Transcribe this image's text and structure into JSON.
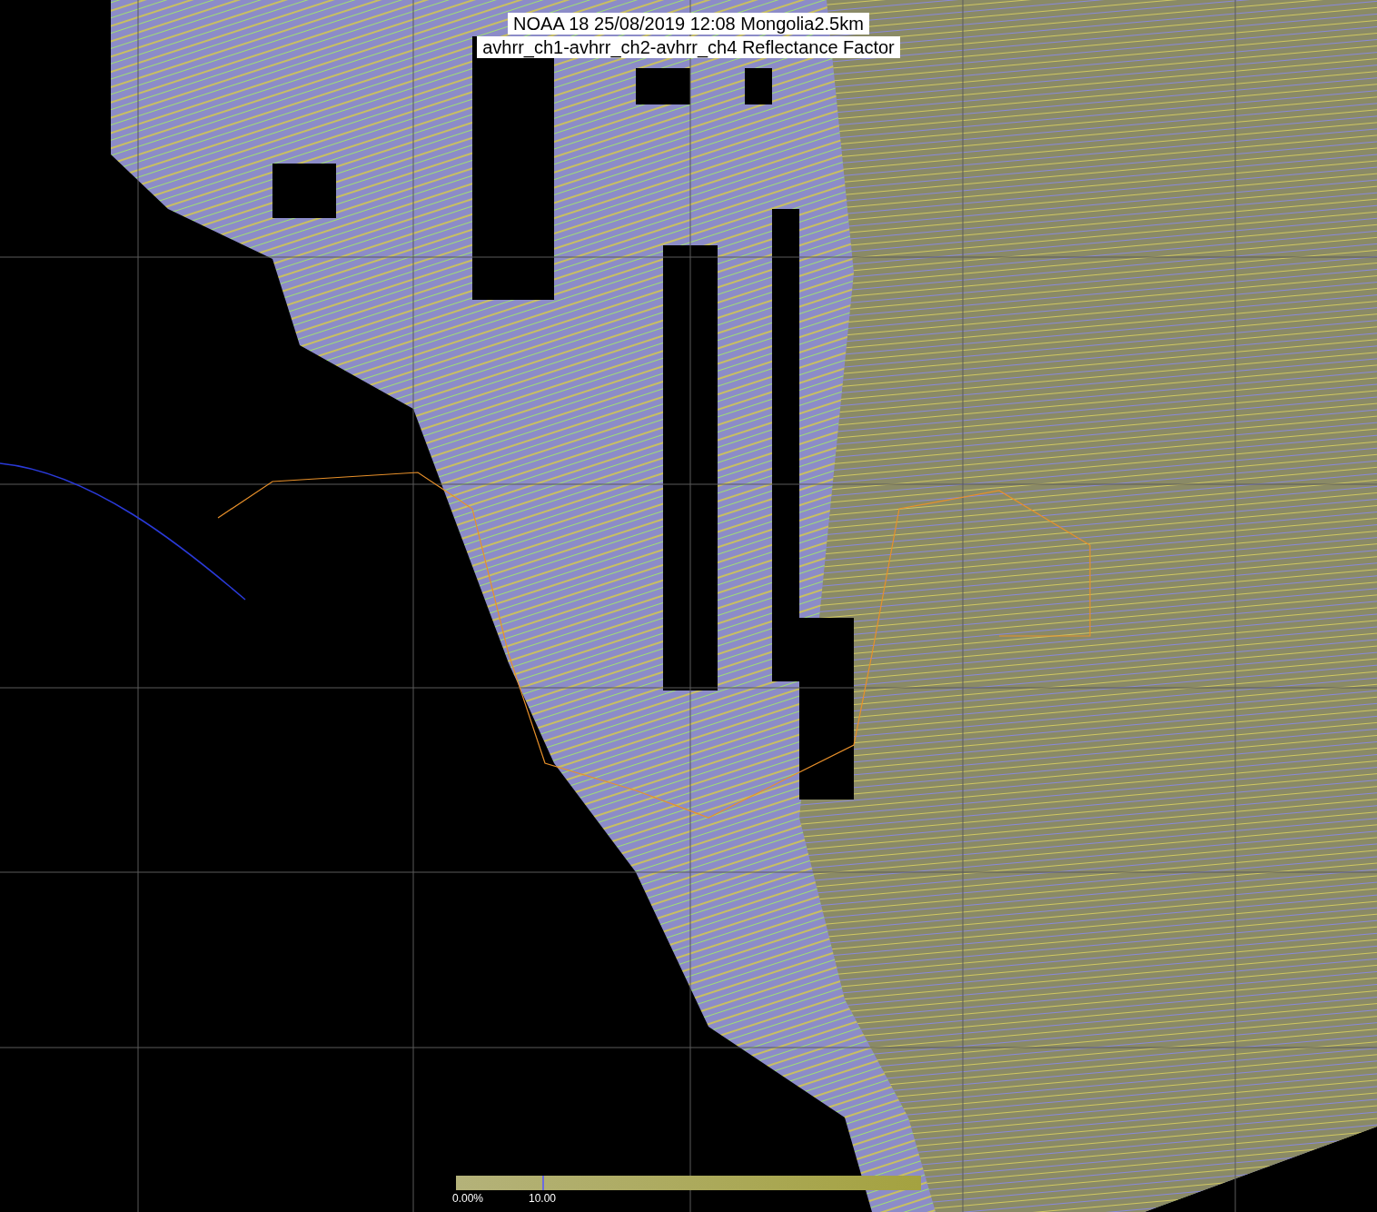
{
  "map": {
    "title_lines": [
      "NOAA 18 25/08/2019 12:08 Mongolia2.5km",
      "avhrr_ch1-avhrr_ch2-avhrr_ch4 Reflectance Factor"
    ]
  },
  "colorbar": {
    "tick_labels": [
      "0.00%",
      "10.00"
    ]
  }
}
